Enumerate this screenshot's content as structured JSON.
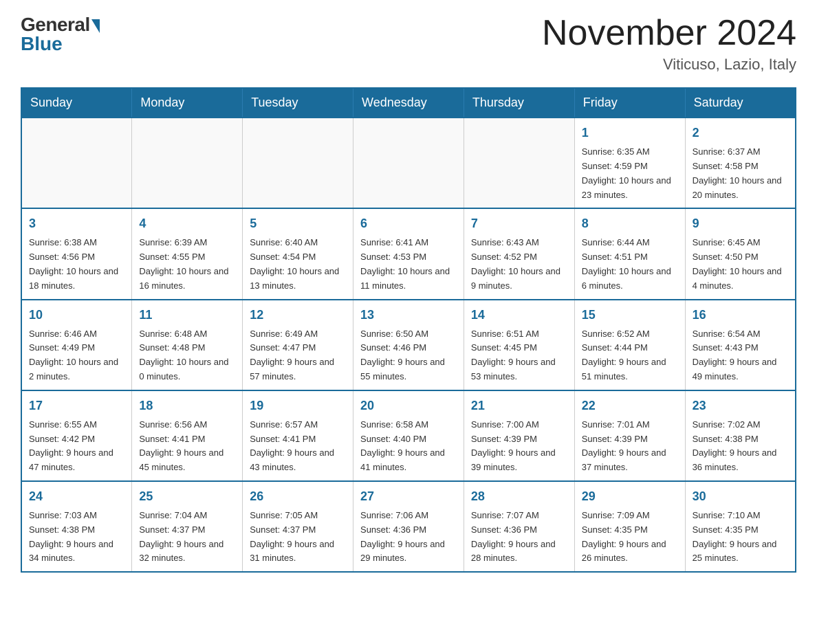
{
  "header": {
    "logo_general": "General",
    "logo_blue": "Blue",
    "month_title": "November 2024",
    "location": "Viticuso, Lazio, Italy"
  },
  "calendar": {
    "days_of_week": [
      "Sunday",
      "Monday",
      "Tuesday",
      "Wednesday",
      "Thursday",
      "Friday",
      "Saturday"
    ],
    "weeks": [
      [
        {
          "day": "",
          "info": ""
        },
        {
          "day": "",
          "info": ""
        },
        {
          "day": "",
          "info": ""
        },
        {
          "day": "",
          "info": ""
        },
        {
          "day": "",
          "info": ""
        },
        {
          "day": "1",
          "info": "Sunrise: 6:35 AM\nSunset: 4:59 PM\nDaylight: 10 hours and 23 minutes."
        },
        {
          "day": "2",
          "info": "Sunrise: 6:37 AM\nSunset: 4:58 PM\nDaylight: 10 hours and 20 minutes."
        }
      ],
      [
        {
          "day": "3",
          "info": "Sunrise: 6:38 AM\nSunset: 4:56 PM\nDaylight: 10 hours and 18 minutes."
        },
        {
          "day": "4",
          "info": "Sunrise: 6:39 AM\nSunset: 4:55 PM\nDaylight: 10 hours and 16 minutes."
        },
        {
          "day": "5",
          "info": "Sunrise: 6:40 AM\nSunset: 4:54 PM\nDaylight: 10 hours and 13 minutes."
        },
        {
          "day": "6",
          "info": "Sunrise: 6:41 AM\nSunset: 4:53 PM\nDaylight: 10 hours and 11 minutes."
        },
        {
          "day": "7",
          "info": "Sunrise: 6:43 AM\nSunset: 4:52 PM\nDaylight: 10 hours and 9 minutes."
        },
        {
          "day": "8",
          "info": "Sunrise: 6:44 AM\nSunset: 4:51 PM\nDaylight: 10 hours and 6 minutes."
        },
        {
          "day": "9",
          "info": "Sunrise: 6:45 AM\nSunset: 4:50 PM\nDaylight: 10 hours and 4 minutes."
        }
      ],
      [
        {
          "day": "10",
          "info": "Sunrise: 6:46 AM\nSunset: 4:49 PM\nDaylight: 10 hours and 2 minutes."
        },
        {
          "day": "11",
          "info": "Sunrise: 6:48 AM\nSunset: 4:48 PM\nDaylight: 10 hours and 0 minutes."
        },
        {
          "day": "12",
          "info": "Sunrise: 6:49 AM\nSunset: 4:47 PM\nDaylight: 9 hours and 57 minutes."
        },
        {
          "day": "13",
          "info": "Sunrise: 6:50 AM\nSunset: 4:46 PM\nDaylight: 9 hours and 55 minutes."
        },
        {
          "day": "14",
          "info": "Sunrise: 6:51 AM\nSunset: 4:45 PM\nDaylight: 9 hours and 53 minutes."
        },
        {
          "day": "15",
          "info": "Sunrise: 6:52 AM\nSunset: 4:44 PM\nDaylight: 9 hours and 51 minutes."
        },
        {
          "day": "16",
          "info": "Sunrise: 6:54 AM\nSunset: 4:43 PM\nDaylight: 9 hours and 49 minutes."
        }
      ],
      [
        {
          "day": "17",
          "info": "Sunrise: 6:55 AM\nSunset: 4:42 PM\nDaylight: 9 hours and 47 minutes."
        },
        {
          "day": "18",
          "info": "Sunrise: 6:56 AM\nSunset: 4:41 PM\nDaylight: 9 hours and 45 minutes."
        },
        {
          "day": "19",
          "info": "Sunrise: 6:57 AM\nSunset: 4:41 PM\nDaylight: 9 hours and 43 minutes."
        },
        {
          "day": "20",
          "info": "Sunrise: 6:58 AM\nSunset: 4:40 PM\nDaylight: 9 hours and 41 minutes."
        },
        {
          "day": "21",
          "info": "Sunrise: 7:00 AM\nSunset: 4:39 PM\nDaylight: 9 hours and 39 minutes."
        },
        {
          "day": "22",
          "info": "Sunrise: 7:01 AM\nSunset: 4:39 PM\nDaylight: 9 hours and 37 minutes."
        },
        {
          "day": "23",
          "info": "Sunrise: 7:02 AM\nSunset: 4:38 PM\nDaylight: 9 hours and 36 minutes."
        }
      ],
      [
        {
          "day": "24",
          "info": "Sunrise: 7:03 AM\nSunset: 4:38 PM\nDaylight: 9 hours and 34 minutes."
        },
        {
          "day": "25",
          "info": "Sunrise: 7:04 AM\nSunset: 4:37 PM\nDaylight: 9 hours and 32 minutes."
        },
        {
          "day": "26",
          "info": "Sunrise: 7:05 AM\nSunset: 4:37 PM\nDaylight: 9 hours and 31 minutes."
        },
        {
          "day": "27",
          "info": "Sunrise: 7:06 AM\nSunset: 4:36 PM\nDaylight: 9 hours and 29 minutes."
        },
        {
          "day": "28",
          "info": "Sunrise: 7:07 AM\nSunset: 4:36 PM\nDaylight: 9 hours and 28 minutes."
        },
        {
          "day": "29",
          "info": "Sunrise: 7:09 AM\nSunset: 4:35 PM\nDaylight: 9 hours and 26 minutes."
        },
        {
          "day": "30",
          "info": "Sunrise: 7:10 AM\nSunset: 4:35 PM\nDaylight: 9 hours and 25 minutes."
        }
      ]
    ]
  }
}
